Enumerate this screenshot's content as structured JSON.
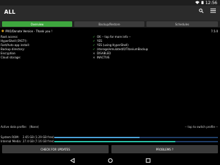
{
  "statusbar": {
    "time": "12:56"
  },
  "appbar": {
    "title": "ALL"
  },
  "tabs": [
    {
      "label": "Overview"
    },
    {
      "label": "Backup/Restore"
    },
    {
      "label": "Schedules"
    }
  ],
  "overview": {
    "version_text": "PRO/Donate Version - Thank you !",
    "version_number": "7.5.0",
    "rows": [
      {
        "label": "Root access:",
        "mark": "✔",
        "value": "OK -- tap for more info --"
      },
      {
        "label": "HyperShell (FAST!):",
        "mark": "✔",
        "value": "YES"
      },
      {
        "label": "Fast/Auto app install:",
        "mark": "✔",
        "value": "YES (using HyperShell)"
      },
      {
        "label": "Backup directory:",
        "mark": "✔",
        "value": "/storage/emulated/0/TitaniumBackup"
      },
      {
        "label": "Encryption",
        "mark": "✕",
        "value": "DISABLED"
      },
      {
        "label": "Cloud storage:",
        "mark": "✕",
        "value": "INACTIVE"
      }
    ]
  },
  "profile": {
    "label": "Active data profile:",
    "value": "(None)",
    "switch_hint": "-- tap to switch profile --"
  },
  "storage": [
    {
      "name": "System ROM:",
      "value": "2.65 GB (1.29 GB free)",
      "fill_fraction": 0.52,
      "color": "#4aa0d8"
    },
    {
      "name": "Internal Media:",
      "value": "27.4 GB (7.16 GB free)",
      "fill_fraction": 0.74,
      "color": "#28c0a6"
    }
  ],
  "buttons": {
    "check_updates": "CHECK FOR UPDATES",
    "problems": "PROBLEMS ?"
  },
  "colors": {
    "accent": "#3ea63e",
    "appbar": "#2b2b2b",
    "background": "#000000"
  }
}
